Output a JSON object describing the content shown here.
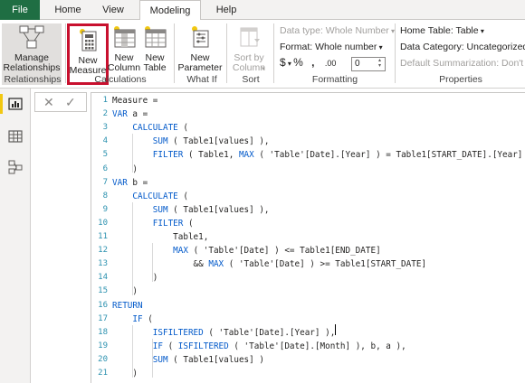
{
  "tabs": {
    "file": "File",
    "home": "Home",
    "view": "View",
    "modeling": "Modeling",
    "help": "Help"
  },
  "ribbon": {
    "manage_relationships": [
      "Manage",
      "Relationships"
    ],
    "new_measure": [
      "New",
      "Measure"
    ],
    "new_column": [
      "New",
      "Column"
    ],
    "new_table": [
      "New",
      "Table"
    ],
    "new_parameter": [
      "New",
      "Parameter"
    ],
    "sort_by_column": [
      "Sort by",
      "Column"
    ],
    "data_type": "Data type: Whole Number",
    "format": "Format: Whole number",
    "currency_symbol": "$",
    "percent_symbol": "%",
    "comma_symbol": ",",
    "decimal_symbol": ".00",
    "decimal_value": "0",
    "home_table": "Home Table: Table",
    "data_category": "Data Category: Uncategorized",
    "default_summarization": "Default Summarization: Don't su",
    "groups": {
      "relationships": "Relationships",
      "calculations": "Calculations",
      "what_if": "What If",
      "sort": "Sort",
      "formatting": "Formatting",
      "properties": "Properties"
    }
  },
  "formula_bar": {
    "cancel_glyph": "✕",
    "commit_glyph": "✓"
  },
  "editor": {
    "lines": [
      {
        "n": "1",
        "text": "Measure ="
      },
      {
        "n": "2",
        "text": "VAR a ="
      },
      {
        "n": "3",
        "text": "    CALCULATE ("
      },
      {
        "n": "4",
        "text": "        SUM ( Table1[values] ),"
      },
      {
        "n": "5",
        "text": "        FILTER ( Table1, MAX ( 'Table'[Date].[Year] ) = Table1[START_DATE].[Year] )"
      },
      {
        "n": "6",
        "text": "    )"
      },
      {
        "n": "7",
        "text": "VAR b ="
      },
      {
        "n": "8",
        "text": "    CALCULATE ("
      },
      {
        "n": "9",
        "text": "        SUM ( Table1[values] ),"
      },
      {
        "n": "10",
        "text": "        FILTER ("
      },
      {
        "n": "11",
        "text": "            Table1,"
      },
      {
        "n": "12",
        "text": "            MAX ( 'Table'[Date] ) <= Table1[END_DATE]"
      },
      {
        "n": "13",
        "text": "                && MAX ( 'Table'[Date] ) >= Table1[START_DATE]"
      },
      {
        "n": "14",
        "text": "        )"
      },
      {
        "n": "15",
        "text": "    )"
      },
      {
        "n": "16",
        "text": "RETURN"
      },
      {
        "n": "17",
        "text": "    IF ("
      },
      {
        "n": "18",
        "text": "        ISFILTERED ( 'Table'[Date].[Year] ),"
      },
      {
        "n": "19",
        "text": "        IF ( ISFILTERED ( 'Table'[Date].[Month] ), b, a ),"
      },
      {
        "n": "20",
        "text": "        SUM ( Table1[values] )"
      },
      {
        "n": "21",
        "text": "    )"
      }
    ]
  },
  "colors": {
    "file_tab": "#1f6e43",
    "highlight_box": "#c8102e",
    "keyword": "#035aca",
    "line_numbers": "#2b91af",
    "active_nav": "#f2c811"
  }
}
